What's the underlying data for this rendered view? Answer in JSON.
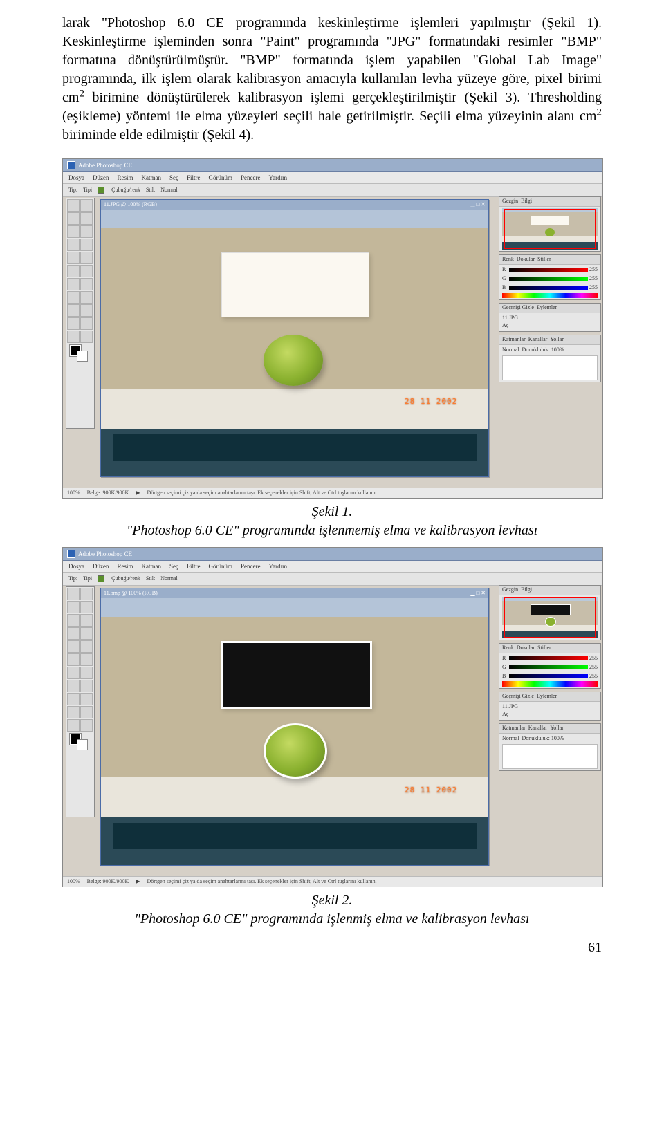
{
  "body_paragraph": "larak \"Photoshop 6.0 CE programında keskinleştirme işlemleri yapılmıştır (Şekil 1). Keskinleştirme işleminden sonra \"Paint\" programında \"JPG\" formatındaki resimler \"BMP\" formatına dönüştürülmüştür. \"BMP\" formatında işlem yapabilen \"Global Lab Image\" programında, ilk işlem olarak kalibrasyon amacıyla kullanılan levha yüzeye göre, pixel birimi cm",
  "body_paragraph_super": "2",
  "body_paragraph_cont": " birimine dönüştürülerek kalibrasyon işlemi gerçekleştirilmiştir (Şekil 3). Thresholding (eşikleme) yöntemi ile elma yüzeyleri seçili hale getirilmiştir. Seçili elma yüzeyinin alanı cm",
  "body_paragraph_super2": "2",
  "body_paragraph_end": " biriminde elde edilmiştir (Şekil 4).",
  "figure1": {
    "label": "Şekil 1.",
    "caption": "\"Photoshop 6.0 CE\" programında işlenmemiş elma ve kalibrasyon levhası"
  },
  "figure2": {
    "label": "Şekil 2.",
    "caption": "\"Photoshop 6.0 CE\" programında işlenmiş elma ve kalibrasyon levhası"
  },
  "page_number": "61",
  "photoshop": {
    "title": "Adobe Photoshop CE",
    "menu": [
      "Dosya",
      "Düzen",
      "Resim",
      "Katman",
      "Seç",
      "Filtre",
      "Görünüm",
      "Pencere",
      "Yardım"
    ],
    "options": {
      "tip": "Tip:",
      "type_val": "Tipi",
      "cb1": "Çubuğu/renk",
      "style_label": "Stil:",
      "style_val": "Normal"
    },
    "doc_title": "11.JPG @ 100% (RGB)",
    "doc_title2": "11.bmp @ 100% (RGB)",
    "date": "28 11 2002",
    "zoom": "100%",
    "status_doc": "Belge: 900K/900K",
    "status_tip": "Dörtgen seçimi çiz ya da seçim anahtarlarını taşı. Ek seçenekler için Shift, Alt ve Ctrl tuşlarını kullanın.",
    "palettes": {
      "nav": {
        "tab": "Gezgin",
        "tab2": "Bilgi"
      },
      "color": {
        "tab": "Renk",
        "tab2": "Dokular",
        "tab3": "Stiller"
      },
      "history": {
        "tab": "Geçmişi Gizle",
        "tab2": "Eylemler",
        "items": [
          "11.JPG",
          "Aç"
        ]
      },
      "layers": {
        "tab": "Katmanlar",
        "tab2": "Kanallar",
        "tab3": "Yollar",
        "mode": "Normal",
        "opacity": "Donukluluk: 100%"
      }
    }
  }
}
